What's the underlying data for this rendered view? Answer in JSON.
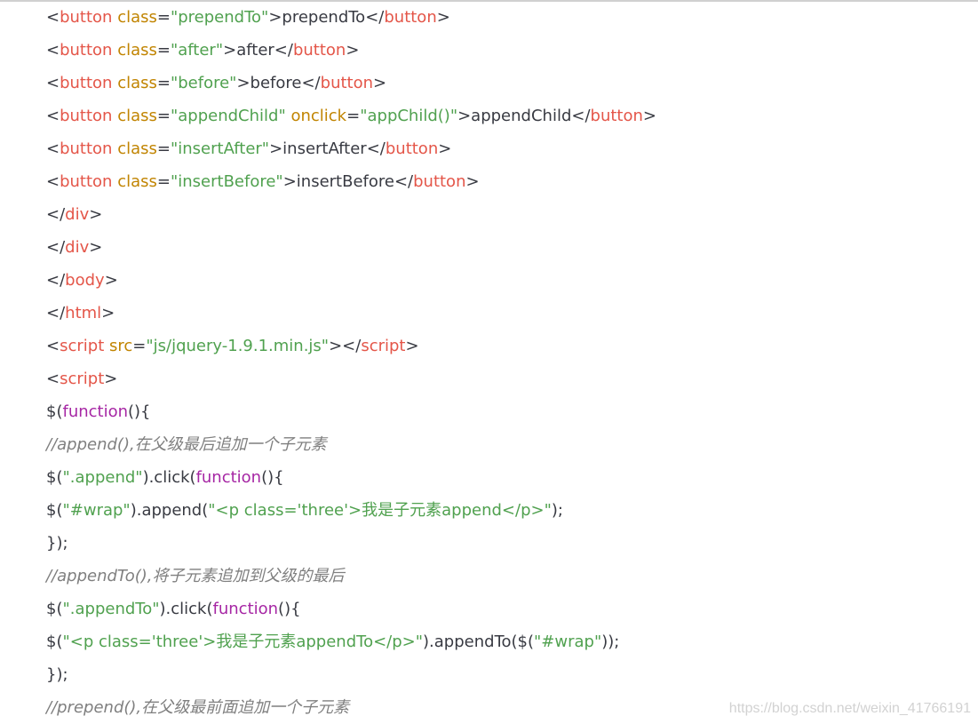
{
  "lines": [
    [
      {
        "t": "<",
        "c": "pl"
      },
      {
        "t": "button",
        "c": "tag"
      },
      {
        "t": " class",
        "c": "attr"
      },
      {
        "t": "=",
        "c": "pl"
      },
      {
        "t": "\"prependTo\"",
        "c": "str"
      },
      {
        "t": ">prependTo</",
        "c": "pl"
      },
      {
        "t": "button",
        "c": "tag"
      },
      {
        "t": ">",
        "c": "pl"
      }
    ],
    [
      {
        "t": "<",
        "c": "pl"
      },
      {
        "t": "button",
        "c": "tag"
      },
      {
        "t": " class",
        "c": "attr"
      },
      {
        "t": "=",
        "c": "pl"
      },
      {
        "t": "\"after\"",
        "c": "str"
      },
      {
        "t": ">after</",
        "c": "pl"
      },
      {
        "t": "button",
        "c": "tag"
      },
      {
        "t": ">",
        "c": "pl"
      }
    ],
    [
      {
        "t": "<",
        "c": "pl"
      },
      {
        "t": "button",
        "c": "tag"
      },
      {
        "t": " class",
        "c": "attr"
      },
      {
        "t": "=",
        "c": "pl"
      },
      {
        "t": "\"before\"",
        "c": "str"
      },
      {
        "t": ">before</",
        "c": "pl"
      },
      {
        "t": "button",
        "c": "tag"
      },
      {
        "t": ">",
        "c": "pl"
      }
    ],
    [
      {
        "t": "<",
        "c": "pl"
      },
      {
        "t": "button",
        "c": "tag"
      },
      {
        "t": " class",
        "c": "attr"
      },
      {
        "t": "=",
        "c": "pl"
      },
      {
        "t": "\"appendChild\"",
        "c": "str"
      },
      {
        "t": " onclick",
        "c": "attr"
      },
      {
        "t": "=",
        "c": "pl"
      },
      {
        "t": "\"appChild()\"",
        "c": "str"
      },
      {
        "t": ">appendChild</",
        "c": "pl"
      },
      {
        "t": "button",
        "c": "tag"
      },
      {
        "t": ">",
        "c": "pl"
      }
    ],
    [
      {
        "t": "<",
        "c": "pl"
      },
      {
        "t": "button",
        "c": "tag"
      },
      {
        "t": " class",
        "c": "attr"
      },
      {
        "t": "=",
        "c": "pl"
      },
      {
        "t": "\"insertAfter\"",
        "c": "str"
      },
      {
        "t": ">insertAfter</",
        "c": "pl"
      },
      {
        "t": "button",
        "c": "tag"
      },
      {
        "t": ">",
        "c": "pl"
      }
    ],
    [
      {
        "t": "<",
        "c": "pl"
      },
      {
        "t": "button",
        "c": "tag"
      },
      {
        "t": " class",
        "c": "attr"
      },
      {
        "t": "=",
        "c": "pl"
      },
      {
        "t": "\"insertBefore\"",
        "c": "str"
      },
      {
        "t": ">insertBefore</",
        "c": "pl"
      },
      {
        "t": "button",
        "c": "tag"
      },
      {
        "t": ">",
        "c": "pl"
      }
    ],
    [
      {
        "t": "</",
        "c": "pl"
      },
      {
        "t": "div",
        "c": "tag"
      },
      {
        "t": ">",
        "c": "pl"
      }
    ],
    [
      {
        "t": "</",
        "c": "pl"
      },
      {
        "t": "div",
        "c": "tag"
      },
      {
        "t": ">",
        "c": "pl"
      }
    ],
    [
      {
        "t": "</",
        "c": "pl"
      },
      {
        "t": "body",
        "c": "tag"
      },
      {
        "t": ">",
        "c": "pl"
      }
    ],
    [
      {
        "t": "</",
        "c": "pl"
      },
      {
        "t": "html",
        "c": "tag"
      },
      {
        "t": ">",
        "c": "pl"
      }
    ],
    [
      {
        "t": "<",
        "c": "pl"
      },
      {
        "t": "script",
        "c": "tag"
      },
      {
        "t": " src",
        "c": "attr"
      },
      {
        "t": "=",
        "c": "pl"
      },
      {
        "t": "\"js/jquery-1.9.1.min.js\"",
        "c": "str"
      },
      {
        "t": "></",
        "c": "pl"
      },
      {
        "t": "script",
        "c": "tag"
      },
      {
        "t": ">",
        "c": "pl"
      }
    ],
    [
      {
        "t": "<",
        "c": "pl"
      },
      {
        "t": "script",
        "c": "tag"
      },
      {
        "t": ">",
        "c": "pl"
      }
    ],
    [
      {
        "t": "$(",
        "c": "pl"
      },
      {
        "t": "function",
        "c": "kw"
      },
      {
        "t": "(){",
        "c": "pl"
      }
    ],
    [
      {
        "t": "//append(),在父级最后追加一个子元素",
        "c": "cm"
      }
    ],
    [
      {
        "t": "$(",
        "c": "pl"
      },
      {
        "t": "\".append\"",
        "c": "str"
      },
      {
        "t": ").click(",
        "c": "pl"
      },
      {
        "t": "function",
        "c": "kw"
      },
      {
        "t": "(){",
        "c": "pl"
      }
    ],
    [
      {
        "t": "$(",
        "c": "pl"
      },
      {
        "t": "\"#wrap\"",
        "c": "str"
      },
      {
        "t": ").append(",
        "c": "pl"
      },
      {
        "t": "\"<p class='three'>我是子元素append</p>\"",
        "c": "str"
      },
      {
        "t": ");",
        "c": "pl"
      }
    ],
    [
      {
        "t": "});",
        "c": "pl"
      }
    ],
    [
      {
        "t": "//appendTo(),将子元素追加到父级的最后",
        "c": "cm"
      }
    ],
    [
      {
        "t": "$(",
        "c": "pl"
      },
      {
        "t": "\".appendTo\"",
        "c": "str"
      },
      {
        "t": ").click(",
        "c": "pl"
      },
      {
        "t": "function",
        "c": "kw"
      },
      {
        "t": "(){",
        "c": "pl"
      }
    ],
    [
      {
        "t": "$(",
        "c": "pl"
      },
      {
        "t": "\"<p class='three'>我是子元素appendTo</p>\"",
        "c": "str"
      },
      {
        "t": ").appendTo($(",
        "c": "pl"
      },
      {
        "t": "\"#wrap\"",
        "c": "str"
      },
      {
        "t": "));",
        "c": "pl"
      }
    ],
    [
      {
        "t": "});",
        "c": "pl"
      }
    ],
    [
      {
        "t": "//prepend(),在父级最前面追加一个子元素",
        "c": "cm"
      }
    ]
  ],
  "watermark": "https://blog.csdn.net/weixin_41766191",
  "colors": {
    "tag": "#e45649",
    "attr": "#c18401",
    "string": "#50a14f",
    "keyword": "#a626a4",
    "comment": "#7f7f7f",
    "plain": "#383a42"
  }
}
